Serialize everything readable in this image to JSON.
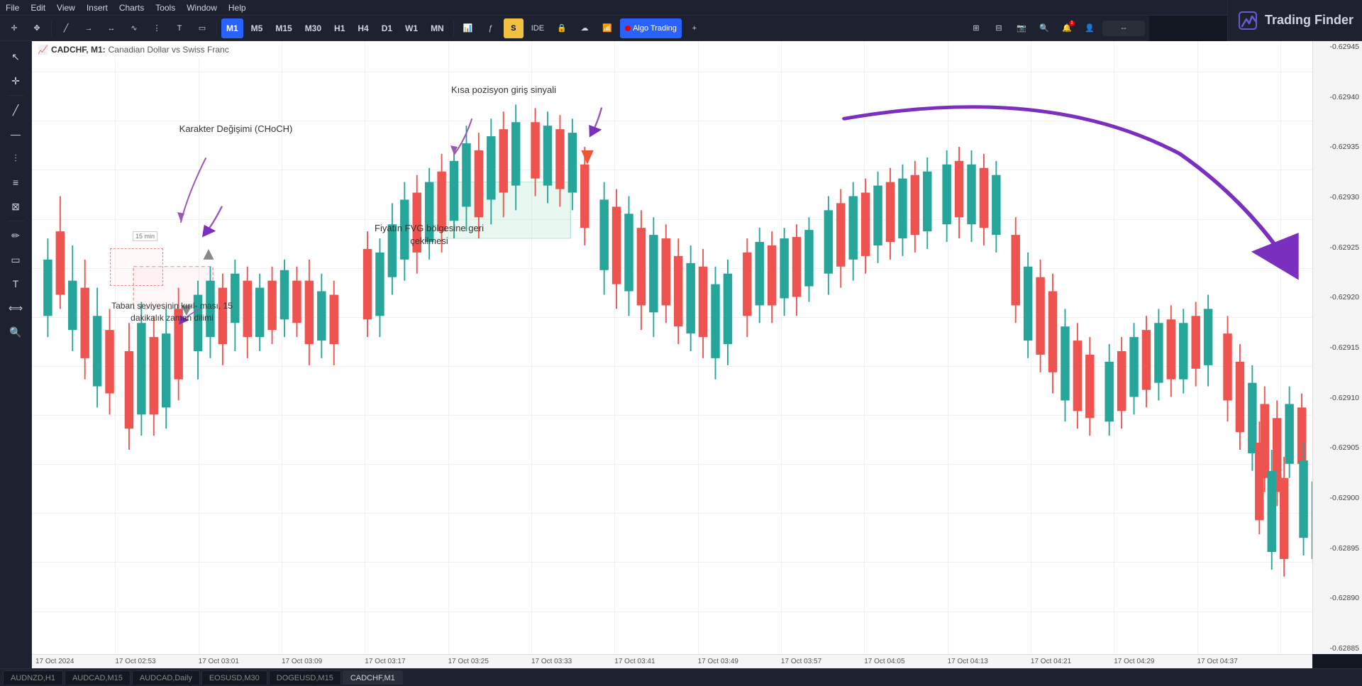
{
  "menuBar": {
    "items": [
      "File",
      "Edit",
      "View",
      "Insert",
      "Charts",
      "Tools",
      "Window",
      "Help"
    ]
  },
  "toolbar": {
    "timeframes": [
      "M1",
      "M5",
      "M15",
      "M30",
      "H1",
      "H4",
      "D1",
      "W1",
      "MN"
    ],
    "activeTimeframe": "M1",
    "algoTrading": "Algo Trading",
    "ideLabel": "IDE"
  },
  "chartHeader": {
    "symbol": "CADCHF, M1:",
    "description": "Canadian Dollar vs Swiss Franc",
    "icon": "CADCHF"
  },
  "priceScale": {
    "labels": [
      "-0.62945",
      "-0.62940",
      "-0.62935",
      "-0.62930",
      "-0.62925",
      "-0.62920",
      "-0.62915",
      "-0.62910",
      "-0.62905",
      "-0.62900",
      "-0.62895",
      "-0.62890",
      "-0.62885"
    ]
  },
  "timeScale": {
    "labels": [
      "17 Oct 2024",
      "17 Oct 02:53",
      "17 Oct 03:01",
      "17 Oct 03:09",
      "17 Oct 03:17",
      "17 Oct 03:25",
      "17 Oct 03:33",
      "17 Oct 03:41",
      "17 Oct 03:49",
      "17 Oct 03:57",
      "17 Oct 04:05",
      "17 Oct 04:13",
      "17 Oct 04:21",
      "17 Oct 04:29",
      "17 Oct 04:37"
    ]
  },
  "annotations": {
    "karakterDegisimi": "Karakter Değişimi\n(CHoCH)",
    "kisaPozisyon": "Kısa pozisyon giriş\nsinyali",
    "fiyatinFVG": "Fiyatın FVG bölgesine\ngeri çekilmesi",
    "tabanSeviyes": "Taban seviyesinin kırıl-\nması, 15 dakikalık zaman\ndilimi",
    "minLabel": "15 min"
  },
  "bottomTabs": {
    "tabs": [
      "AUDNZD,H1",
      "AUDCAD,M15",
      "AUDCAD,Daily",
      "EOSUSD,M30",
      "DOGEUSD,M15",
      "CADCHF,M1"
    ],
    "activeTab": "CADCHF,M1"
  },
  "tradingFinder": {
    "name": "Trading Finder"
  }
}
